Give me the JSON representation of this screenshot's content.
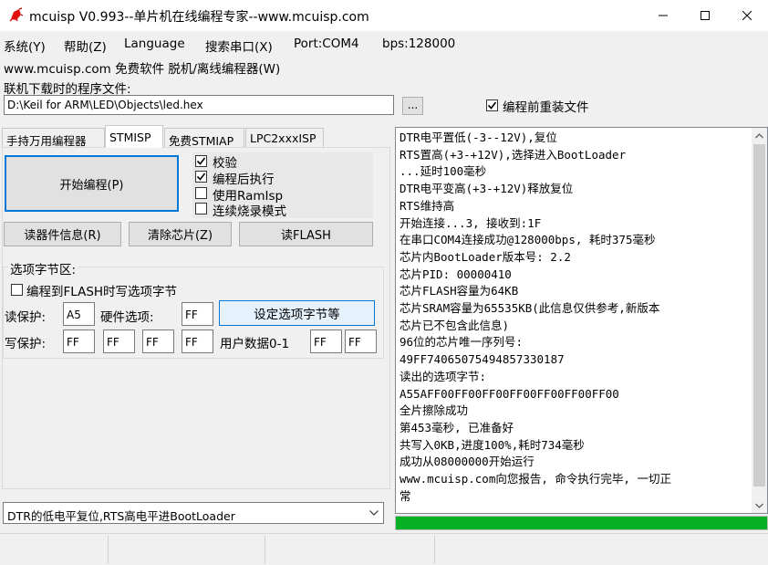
{
  "window": {
    "title": "mcuisp V0.993--单片机在线编程专家--www.mcuisp.com",
    "icon": "bug-app-icon"
  },
  "menu": {
    "items": [
      "系统(Y)",
      "帮助(Z)",
      "Language",
      "搜索串口(X)",
      "Port:COM4",
      "bps:128000"
    ],
    "second_row": "www.mcuisp.com 免费软件 脱机/离线编程器(W)"
  },
  "file": {
    "label": "联机下载时的程序文件:",
    "path": "D:\\Keil for ARM\\LED\\Objects\\led.hex",
    "browse_label": "...",
    "reload_label": "编程前重装文件",
    "reload_checked": true
  },
  "tabs": [
    "手持万用编程器",
    "STMISP",
    "免费STMIAP",
    "LPC2xxxISP"
  ],
  "active_tab": "STMISP",
  "panel": {
    "start_button": "开始编程(P)",
    "options": [
      {
        "label": "校验",
        "checked": true
      },
      {
        "label": "编程后执行",
        "checked": true
      },
      {
        "label": "使用RamIsp",
        "checked": false
      },
      {
        "label": "连续烧录模式",
        "checked": false
      }
    ],
    "read_info_button": "读器件信息(R)",
    "erase_button": "清除芯片(Z)",
    "read_flash_button": "读FLASH",
    "option_bytes": {
      "legend": "选项字节区:",
      "program_to_flash_label": "编程到FLASH时写选项字节",
      "program_to_flash_checked": false,
      "read_protect_label": "读保护:",
      "read_protect_value": "A5",
      "hardware_option_label": "硬件选项:",
      "hardware_option_value": "FF",
      "set_button": "设定选项字节等",
      "write_protect_label": "写保护:",
      "write_protect_values": [
        "FF",
        "FF",
        "FF",
        "FF"
      ],
      "user_data_label": "用户数据0-1",
      "user_data_values": [
        "FF",
        "FF"
      ]
    },
    "dtr_mode": "DTR的低电平复位,RTS高电平进BootLoader"
  },
  "log": [
    "DTR电平置低(-3--12V),复位",
    "RTS置高(+3-+12V),选择进入BootLoader",
    "...延时100毫秒",
    "DTR电平变高(+3-+12V)释放复位",
    "RTS维持高",
    "开始连接...3, 接收到:1F",
    "在串口COM4连接成功@128000bps, 耗时375毫秒",
    "芯片内BootLoader版本号: 2.2",
    "芯片PID: 00000410",
    "芯片FLASH容量为64KB",
    "芯片SRAM容量为65535KB(此信息仅供参考,新版本",
    "芯片已不包含此信息)",
    "96位的芯片唯一序列号:",
    "49FF74065075494857330187",
    "读出的选项字节:",
    "A55AFF00FF00FF00FF00FF00FF00FF00",
    "全片擦除成功",
    "第453毫秒, 已准备好",
    "共写入0KB,进度100%,耗时734毫秒",
    "成功从08000000开始运行",
    "www.mcuisp.com向您报告, 命令执行完毕, 一切正",
    "常"
  ],
  "progress": 1.0,
  "colors": {
    "progress": "#06b025",
    "focus_border": "#0078d7",
    "set_button_bg": "#e5f1fb",
    "app_icon": "#e01010"
  }
}
